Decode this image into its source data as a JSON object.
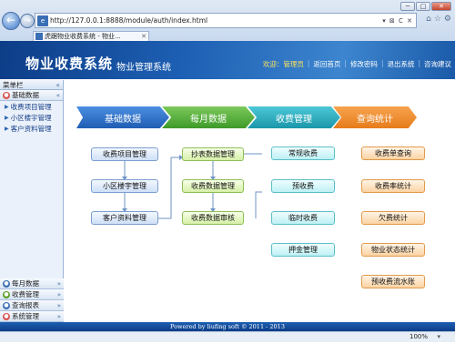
{
  "browser": {
    "url": "http://127.0.0.1:8888/module/auth/index.html",
    "address_tools": "▾ ⊠ C ✕",
    "tab_title": "虎踞物业收费系统 - 物业...",
    "window_buttons": [
      "─",
      "□",
      "✕"
    ],
    "right_tools": [
      "⌂",
      "☆",
      "⚙"
    ],
    "zoom": "100%",
    "back_icon": "←",
    "forward_icon": "→",
    "page_icon": "e",
    "tab_close": "✕",
    "zoom_arrow": "▾"
  },
  "header": {
    "title": "物业收费系统",
    "subtitle": "物业管理系统",
    "welcome": "欢迎：管理员",
    "links": [
      "返回首页",
      "修改密码",
      "退出系统",
      "咨询建议"
    ],
    "sep": "|"
  },
  "sidebar": {
    "title": "菜单栏",
    "collapse_icon": "«",
    "groups_top": [
      {
        "label": "基础数据",
        "chev": "«",
        "color": "#d9534f",
        "icon": "●"
      }
    ],
    "items": [
      "收费项目管理",
      "小区楼宇管理",
      "客户资料管理"
    ],
    "item_marker": "▶",
    "groups_bottom": [
      {
        "label": "每月数据",
        "chev": "»",
        "color": "#3c6fb5",
        "icon": "●"
      },
      {
        "label": "收费管理",
        "chev": "»",
        "color": "#5aa12b",
        "icon": "●"
      },
      {
        "label": "查询报表",
        "chev": "»",
        "color": "#3c6fb5",
        "icon": "●"
      },
      {
        "label": "系统管理",
        "chev": "»",
        "color": "#d9534f",
        "icon": "●"
      }
    ]
  },
  "flow": {
    "stages": [
      {
        "label": "基础数据",
        "color": "#2c6fc6"
      },
      {
        "label": "每月数据",
        "color": "#4ea83a"
      },
      {
        "label": "收费管理",
        "color": "#1fa5b8"
      },
      {
        "label": "查询统计",
        "color": "#ef8a25"
      }
    ],
    "col1": [
      "收费项目管理",
      "小区楼宇管理",
      "客户资料管理"
    ],
    "col2": [
      "抄表数据管理",
      "收费数据管理",
      "收费数据审核"
    ],
    "col3": [
      "常规收费",
      "预收费",
      "临时收费",
      "押金管理"
    ],
    "col4": [
      "收费单查询",
      "收费率统计",
      "欠费统计",
      "物业状态统计",
      "预收费流水账"
    ]
  },
  "footer": {
    "copyright": "Powered by liufing soft © 2011 - 2013"
  }
}
